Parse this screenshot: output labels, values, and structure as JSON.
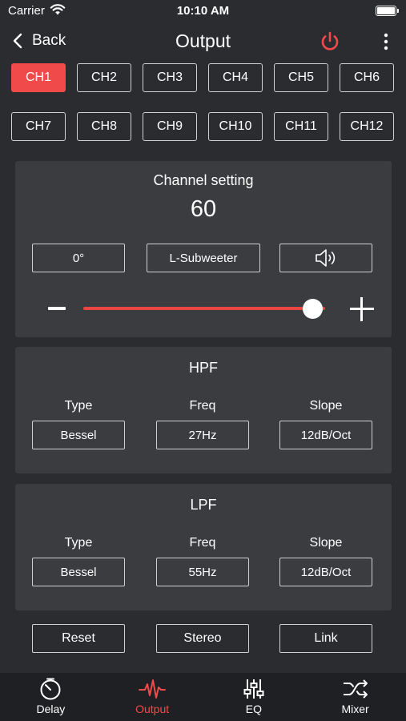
{
  "status": {
    "carrier": "Carrier",
    "time": "10:10 AM"
  },
  "nav": {
    "back_label": "Back",
    "title": "Output"
  },
  "channels": [
    "CH1",
    "CH2",
    "CH3",
    "CH4",
    "CH5",
    "CH6",
    "CH7",
    "CH8",
    "CH9",
    "CH10",
    "CH11",
    "CH12"
  ],
  "active_channel": "CH1",
  "channel_setting": {
    "title": "Channel setting",
    "value": "60",
    "phase": "0°",
    "assignment": "L-Subweeter",
    "level_fraction": 0.95
  },
  "hpf": {
    "title": "HPF",
    "type_label": "Type",
    "freq_label": "Freq",
    "slope_label": "Slope",
    "type": "Bessel",
    "freq": "27Hz",
    "slope": "12dB/Oct"
  },
  "lpf": {
    "title": "LPF",
    "type_label": "Type",
    "freq_label": "Freq",
    "slope_label": "Slope",
    "type": "Bessel",
    "freq": "55Hz",
    "slope": "12dB/Oct"
  },
  "actions": {
    "reset": "Reset",
    "stereo": "Stereo",
    "link": "Link"
  },
  "tabs": [
    {
      "label": "Delay",
      "icon": "timer-icon"
    },
    {
      "label": "Output",
      "icon": "waveform-icon"
    },
    {
      "label": "EQ",
      "icon": "sliders-icon"
    },
    {
      "label": "Mixer",
      "icon": "shuffle-icon"
    }
  ],
  "active_tab": "Output",
  "colors": {
    "accent": "#f04a4a",
    "background": "#2a2c30",
    "panel": "#3a3c40",
    "tabbar": "#1f2023"
  }
}
